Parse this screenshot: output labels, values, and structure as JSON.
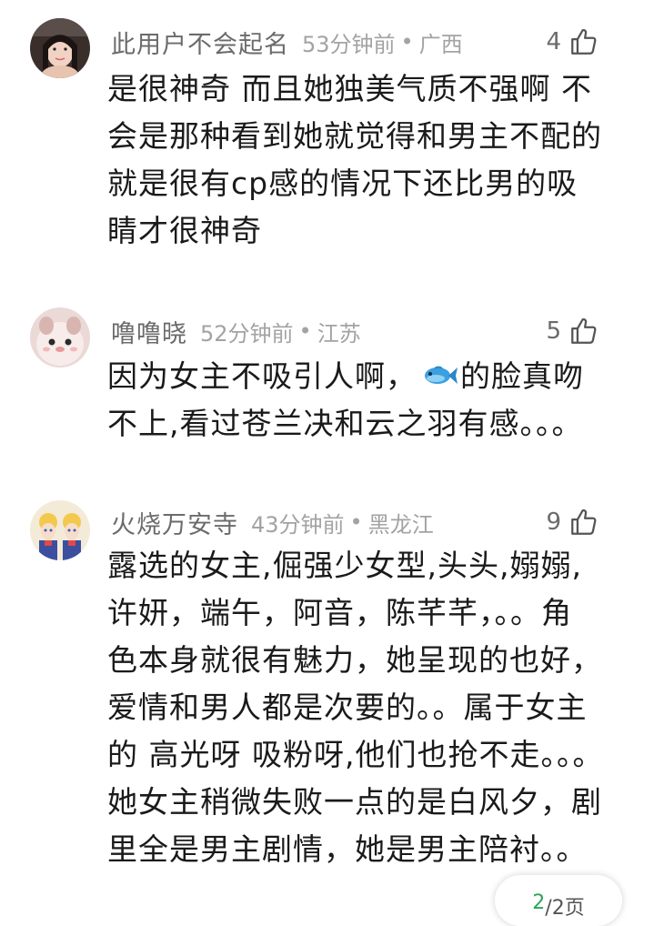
{
  "comments": [
    {
      "username": "此用户不会起名",
      "time": "53分钟前",
      "separator": "•",
      "region": "广西",
      "likes": "4",
      "avatar_icon": "user-avatar-photo",
      "lines": [
        "是很神奇 而且她独美气质不强啊 不",
        "会是那种看到她就觉得和男主不配的",
        "就是很有cp感的情况下还比男的吸",
        "睛才很神奇"
      ]
    },
    {
      "username": "噜噜晓",
      "time": "52分钟前",
      "separator": "•",
      "region": "江苏",
      "likes": "5",
      "avatar_icon": "cartoon-avatar",
      "line1_before": "因为女主不吸引人啊，",
      "line1_emoji": "fish-emoji",
      "line1_after": "的脸真吻",
      "line2": "不上,看过苍兰决和云之羽有感。。。"
    },
    {
      "username": "火烧万安寺",
      "time": "43分钟前",
      "separator": "•",
      "region": "黑龙江",
      "likes": "9",
      "avatar_icon": "anime-avatar",
      "lines": [
        "露选的女主,倔强少女型,头头,嫋嫋,",
        "许妍，端午，阿音，陈芊芊，。。角",
        "色本身就很有魅力，她呈现的也好，",
        "爱情和男人都是次要的。。属于女主",
        "的 高光呀 吸粉呀,他们也抢不走。。。",
        "她女主稍微失败一点的是白风夕，剧",
        "里全是男主剧情，她是男主陪衬。。"
      ]
    }
  ],
  "pager": {
    "current": "2",
    "total": "/2页"
  },
  "colors": {
    "username": "#6b6b6b",
    "meta": "#a3a3a3",
    "text": "#1a1a1a",
    "pager_current": "#2ea55a"
  }
}
